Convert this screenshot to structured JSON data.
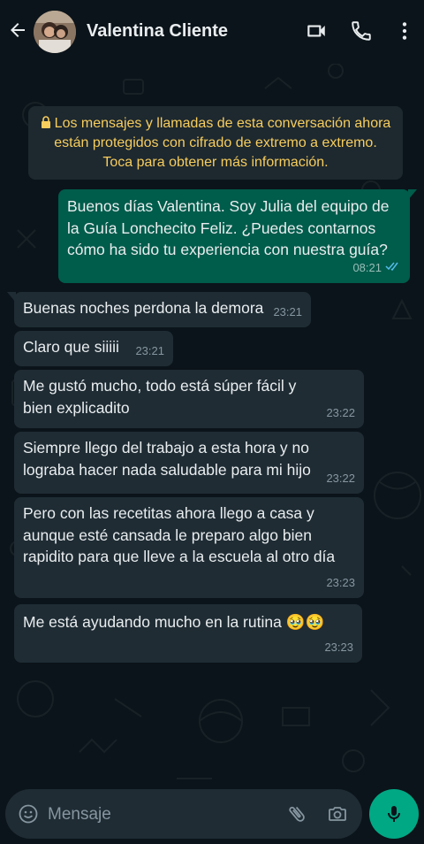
{
  "header": {
    "contact_name": "Valentina Cliente",
    "icons": [
      "back-arrow-icon",
      "video-call-icon",
      "phone-icon",
      "more-vert-icon"
    ]
  },
  "system_notice": "Los mensajes y llamadas de esta conversación ahora están protegidos con cifrado de extremo a extremo. Toca para obtener más información.",
  "messages": [
    {
      "dir": "out",
      "text": "Buenos días Valentina. Soy Julia del equipo de la Guía Lonchecito Feliz. ¿Puedes contarnos cómo ha sido tu experiencia con nuestra guía?",
      "time": "08:21",
      "status": "read"
    },
    {
      "dir": "in",
      "text": "Buenas noches perdona la demora",
      "time": "23:21"
    },
    {
      "dir": "in",
      "text": "Claro que siiiii",
      "time": "23:21"
    },
    {
      "dir": "in",
      "text": "Me gustó mucho, todo está súper fácil y bien explicadito",
      "time": "23:22"
    },
    {
      "dir": "in",
      "text": "Siempre llego del trabajo a esta hora y no lograba hacer nada saludable para mi hijo",
      "time": "23:22"
    },
    {
      "dir": "in",
      "text": "Pero con las recetitas ahora llego a casa y aunque esté cansada le preparo algo bien rapidito para que lleve a la escuela al otro día",
      "time": "23:23"
    },
    {
      "dir": "in",
      "text": "Me está ayudando mucho en la rutina 🥹🥹",
      "time": "23:23"
    }
  ],
  "composer": {
    "placeholder": "Mensaje"
  },
  "colors": {
    "background": "#0b141a",
    "incoming_bubble": "#1f2c34",
    "outgoing_bubble": "#005c4b",
    "notice_text": "#f7cd5d",
    "accent": "#00a884",
    "read_ticks": "#53bdeb"
  }
}
